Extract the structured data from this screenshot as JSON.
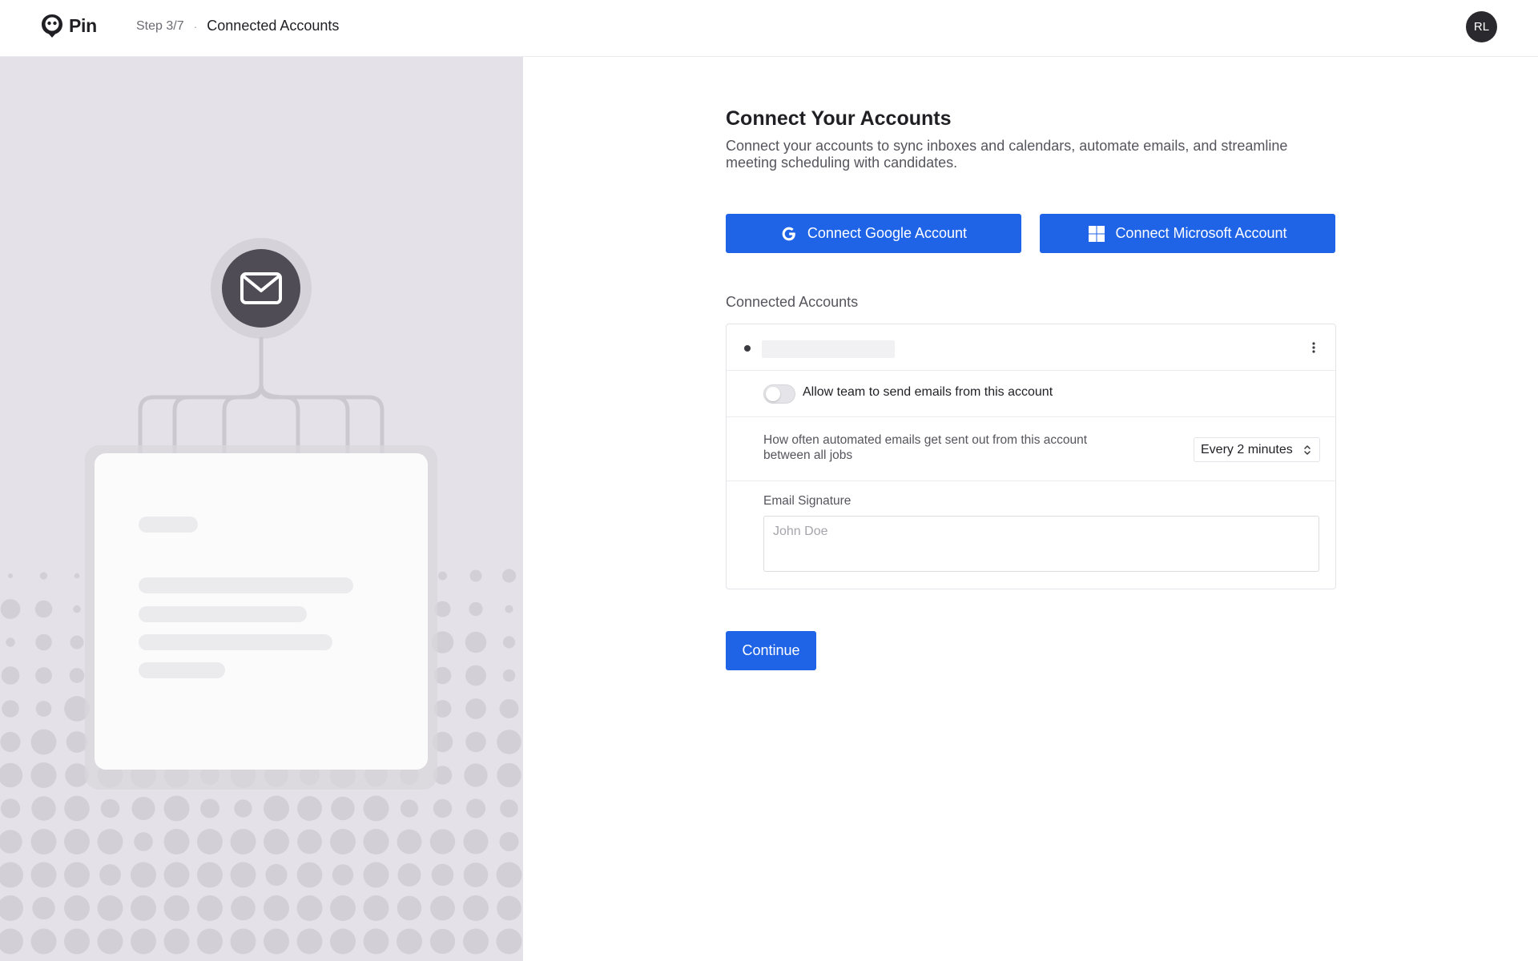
{
  "app": {
    "name": "Pin"
  },
  "header": {
    "step": "Step 3/7",
    "separator": "·",
    "title": "Connected Accounts",
    "avatar_initials": "RL"
  },
  "main": {
    "title": "Connect Your Accounts",
    "description": "Connect your accounts to sync inboxes and calendars, automate emails, and streamline meeting scheduling with candidates.",
    "google_button": "Connect Google Account",
    "microsoft_button": "Connect Microsoft Account",
    "connected_label": "Connected Accounts",
    "account": {
      "allow_team_label": "Allow team to send emails from this account",
      "allow_team_enabled": false,
      "frequency_question": "How often automated emails get sent out from this account between all jobs",
      "frequency_value": "Every 2 minutes",
      "signature_label": "Email Signature",
      "signature_placeholder": "John Doe",
      "signature_value": ""
    },
    "continue_button": "Continue"
  },
  "colors": {
    "primary": "#1f63e6",
    "left_panel_bg": "#e4e2e8",
    "avatar_bg": "#2a2a2e"
  },
  "icons": {
    "logo": "pin-logo-icon",
    "google": "google-g-icon",
    "microsoft": "microsoft-windows-icon",
    "more": "more-vertical-icon",
    "select": "chevron-up-down-icon",
    "illustration": "envelope-icon"
  }
}
